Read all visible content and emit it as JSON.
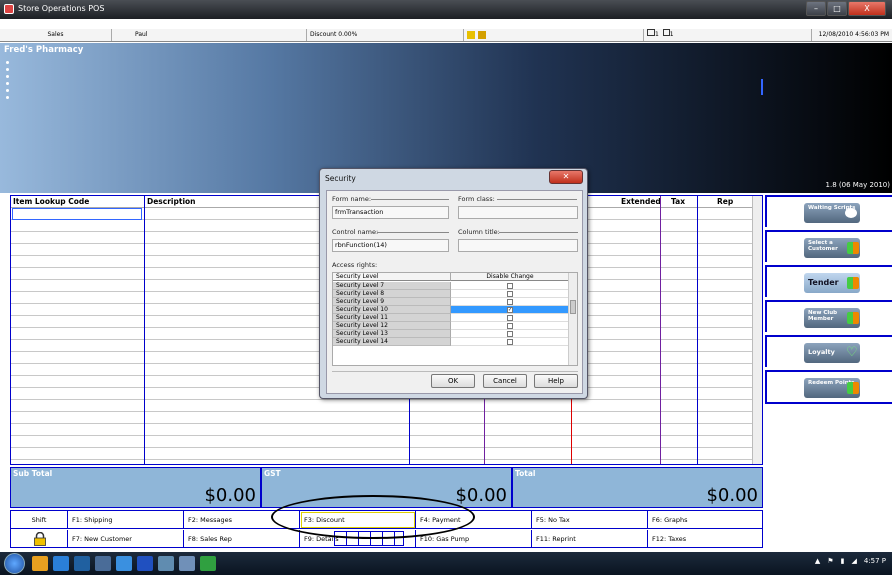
{
  "window": {
    "title": "Store Operations POS",
    "min": "–",
    "max": "□",
    "close": "X"
  },
  "status": {
    "mode": "Sales",
    "user": "Paul",
    "discount": "Discount 0.00%",
    "pages": "1",
    "count": "1",
    "datetime": "12/08/2010 4:56:03 PM"
  },
  "banner": {
    "company": "Fred's Pharmacy",
    "version": "1.8 (06 May 2010)"
  },
  "grid": {
    "columns": [
      "Item Lookup Code",
      "Description",
      "Extended",
      "Tax",
      "Rep"
    ]
  },
  "panel": {
    "buttons": [
      "Waiting Scripts",
      "Select a Customer",
      "Tender",
      "New Club Member",
      "Loyalty",
      "Redeem Points"
    ]
  },
  "totals": {
    "subtotal_label": "Sub Total",
    "subtotal": "$0.00",
    "gst_label": "GST",
    "gst": "$0.00",
    "total_label": "Total",
    "total": "$0.00"
  },
  "fkeys": {
    "row1": [
      "Shift",
      "F1: Shipping",
      "F2: Messages",
      "F3: Discount",
      "F4: Payment",
      "F5: No Tax",
      "F6: Graphs"
    ],
    "row2": [
      "",
      "F7: New Customer",
      "F8: Sales Rep",
      "F9: Details",
      "F10: Gas Pump",
      "F11: Reprint",
      "F12: Taxes"
    ]
  },
  "dialog": {
    "title": "Security",
    "form_name_label": "Form name:",
    "form_name": "frmTransaction",
    "form_class_label": "Form class:",
    "form_class": "",
    "control_name_label": "Control name:",
    "control_name": "rbnFunction(14)",
    "column_title_label": "Column title:",
    "column_title": "",
    "access_label": "Access rights:",
    "col_level": "Security Level",
    "col_disable": "Disable Change",
    "rows": [
      {
        "level": "Security Level 7",
        "checked": false
      },
      {
        "level": "Security Level 8",
        "checked": false
      },
      {
        "level": "Security Level 9",
        "checked": false
      },
      {
        "level": "Security Level 10",
        "checked": true
      },
      {
        "level": "Security Level 11",
        "checked": false
      },
      {
        "level": "Security Level 12",
        "checked": false
      },
      {
        "level": "Security Level 13",
        "checked": false
      },
      {
        "level": "Security Level 14",
        "checked": false
      }
    ],
    "selected_row": 3,
    "ok": "OK",
    "cancel": "Cancel",
    "help": "Help"
  },
  "taskbar": {
    "time": "4:57 P"
  }
}
